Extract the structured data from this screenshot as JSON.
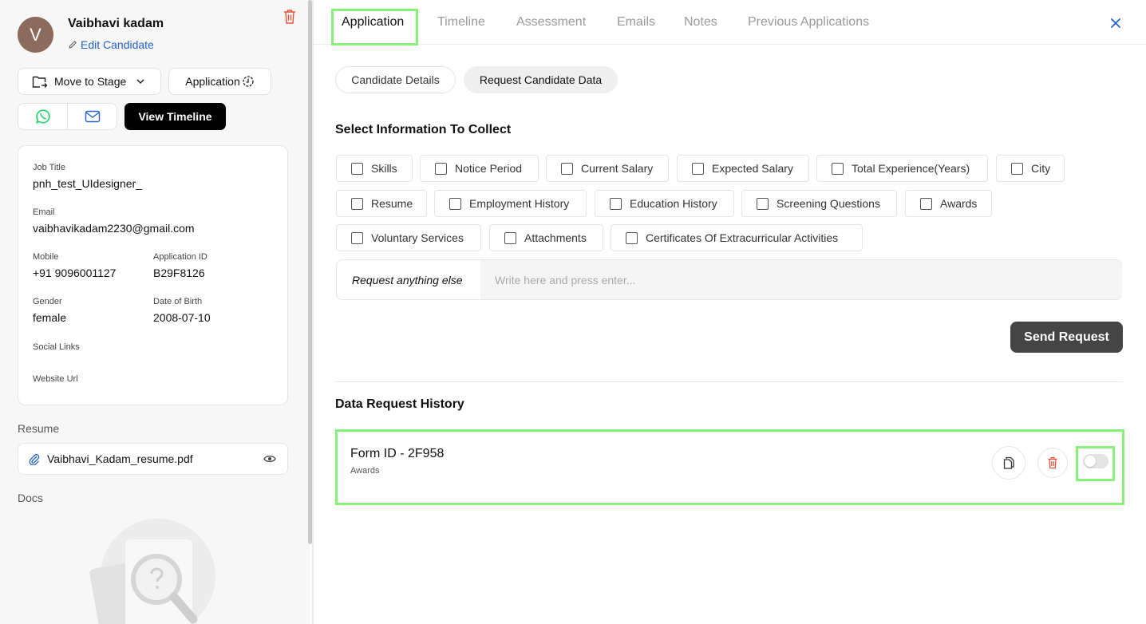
{
  "candidate": {
    "initial": "V",
    "name": "Vaibhavi kadam",
    "edit_label": "Edit Candidate"
  },
  "actions": {
    "move_to_stage": "Move to Stage",
    "application": "Application",
    "view_timeline": "View Timeline"
  },
  "details": {
    "job_title_label": "Job Title",
    "job_title": "pnh_test_UIdesigner_",
    "email_label": "Email",
    "email": "vaibhavikadam2230@gmail.com",
    "mobile_label": "Mobile",
    "mobile": "+91 9096001127",
    "app_id_label": "Application ID",
    "app_id": "B29F8126",
    "gender_label": "Gender",
    "gender": "female",
    "dob_label": "Date of Birth",
    "dob": "2008-07-10",
    "social_label": "Social Links",
    "website_label": "Website Url"
  },
  "resume": {
    "section_label": "Resume",
    "file_name": "Vaibhavi_Kadam_resume.pdf"
  },
  "docs": {
    "section_label": "Docs"
  },
  "tabs": [
    "Application",
    "Timeline",
    "Assessment",
    "Emails",
    "Notes",
    "Previous Applications"
  ],
  "active_tab": "Application",
  "subtabs": [
    "Candidate Details",
    "Request Candidate Data"
  ],
  "active_subtab": "Request Candidate Data",
  "collect": {
    "heading": "Select Information To Collect",
    "options": [
      "Skills",
      "Notice Period",
      "Current Salary",
      "Expected Salary",
      "Total Experience(Years)",
      "City",
      "Resume",
      "Employment History",
      "Education History",
      "Screening Questions",
      "Awards",
      "Voluntary Services",
      "Attachments",
      "Certificates Of Extracurricular Activities"
    ],
    "request_label": "Request anything else",
    "request_placeholder": "Write here and press enter...",
    "send_label": "Send Request"
  },
  "history": {
    "heading": "Data Request History",
    "items": [
      {
        "form_id": "Form ID - 2F958",
        "fields": "Awards",
        "enabled": false
      }
    ]
  },
  "colors": {
    "highlight": "#86f27a",
    "link": "#2563c9",
    "danger": "#e5533d",
    "whatsapp": "#25d366",
    "avatar": "#8b6b5c"
  }
}
